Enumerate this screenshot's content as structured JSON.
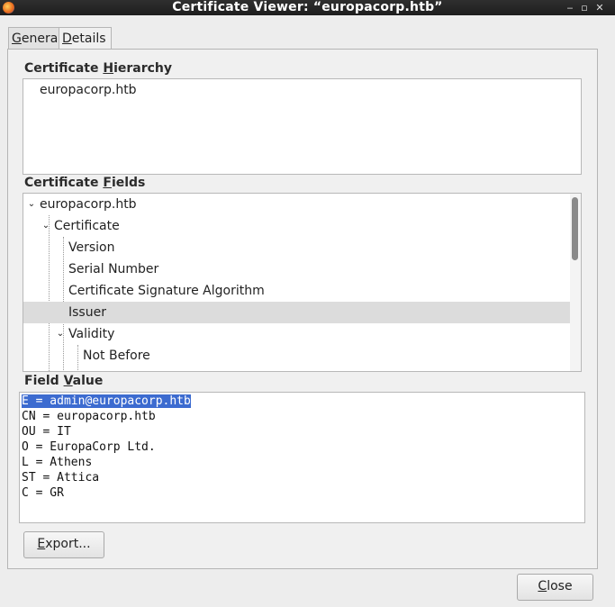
{
  "window": {
    "title": "Certificate Viewer: “europacorp.htb”"
  },
  "tabs": [
    {
      "label_u": "G",
      "label_rest": "eneral"
    },
    {
      "label_u": "D",
      "label_rest": "etails"
    }
  ],
  "hierarchy": {
    "heading_pre": "Certificate ",
    "heading_u": "H",
    "heading_post": "ierarchy",
    "item": "europacorp.htb"
  },
  "fields": {
    "heading_pre": "Certificate ",
    "heading_u": "F",
    "heading_post": "ields",
    "rows": [
      "europacorp.htb",
      "Certificate",
      "Version",
      "Serial Number",
      "Certificate Signature Algorithm",
      "Issuer",
      "Validity",
      "Not Before"
    ],
    "selected": "Issuer"
  },
  "value": {
    "heading_pre": "Field ",
    "heading_u": "V",
    "heading_post": "alue",
    "lines": [
      "E = admin@europacorp.htb",
      "CN = europacorp.htb",
      "OU = IT",
      "O = EuropaCorp Ltd.",
      "L = Athens",
      "ST = Attica",
      "C = GR"
    ]
  },
  "buttons": {
    "export_u": "E",
    "export_rest": "xport...",
    "close_u": "C",
    "close_rest": "lose"
  }
}
